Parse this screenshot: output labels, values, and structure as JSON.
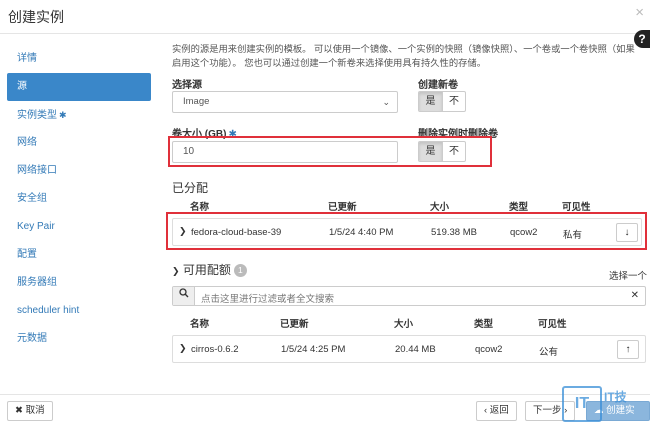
{
  "header": {
    "title": "创建实例",
    "close": "×",
    "help": "?"
  },
  "sidebar": {
    "items": [
      {
        "label": "详情"
      },
      {
        "label": "源"
      },
      {
        "label": "实例类型",
        "required": "✱"
      },
      {
        "label": "网络"
      },
      {
        "label": "网络接口"
      },
      {
        "label": "安全组"
      },
      {
        "label": "Key Pair"
      },
      {
        "label": "配置"
      },
      {
        "label": "服务器组"
      },
      {
        "label": "scheduler hint"
      },
      {
        "label": "元数据"
      }
    ]
  },
  "source": {
    "description": "实例的源是用来创建实例的模板。 可以使用一个镜像、一个实例的快照（镜像快照）、一个卷或一个卷快照（如果启用这个功能）。 您也可以通过创建一个新卷来选择使用具有持久性的存储。",
    "select_source_label": "选择源",
    "select_source_value": "Image",
    "create_volume_label": "创建新卷",
    "yes": "是",
    "no": "不",
    "volume_size_label": "卷大小 (GB)",
    "volume_size_required": "✱",
    "volume_size_value": "10",
    "delete_on_terminate_label": "删除实例时删除卷"
  },
  "allocated": {
    "title": "已分配",
    "columns": {
      "name": "名称",
      "updated": "已更新",
      "size": "大小",
      "type": "类型",
      "visibility": "可见性"
    },
    "row": {
      "name": "fedora-cloud-base-39",
      "updated": "1/5/24 4:40 PM",
      "size": "519.38 MB",
      "type": "qcow2",
      "visibility": "私有",
      "action_icon": "arrow-down-icon"
    }
  },
  "available": {
    "title": "可用配额",
    "count": "1",
    "select_hint": "选择一个",
    "search_placeholder": "点击这里进行过滤或者全文搜索",
    "columns": {
      "name": "名称",
      "updated": "已更新",
      "size": "大小",
      "type": "类型",
      "visibility": "可见性"
    },
    "row": {
      "name": "cirros-0.6.2",
      "updated": "1/5/24 4:25 PM",
      "size": "20.44 MB",
      "type": "qcow2",
      "visibility": "公有",
      "action_icon": "arrow-up-icon"
    }
  },
  "footer": {
    "cancel": "取消",
    "back": "‹ 返回",
    "next": "下一步 ›",
    "create": "创建实例"
  },
  "watermark": {
    "logo": "IT",
    "text": "IT技"
  },
  "colors": {
    "accent": "#3a87c9",
    "highlight_border": "#e0303a",
    "link": "#337ab7"
  }
}
